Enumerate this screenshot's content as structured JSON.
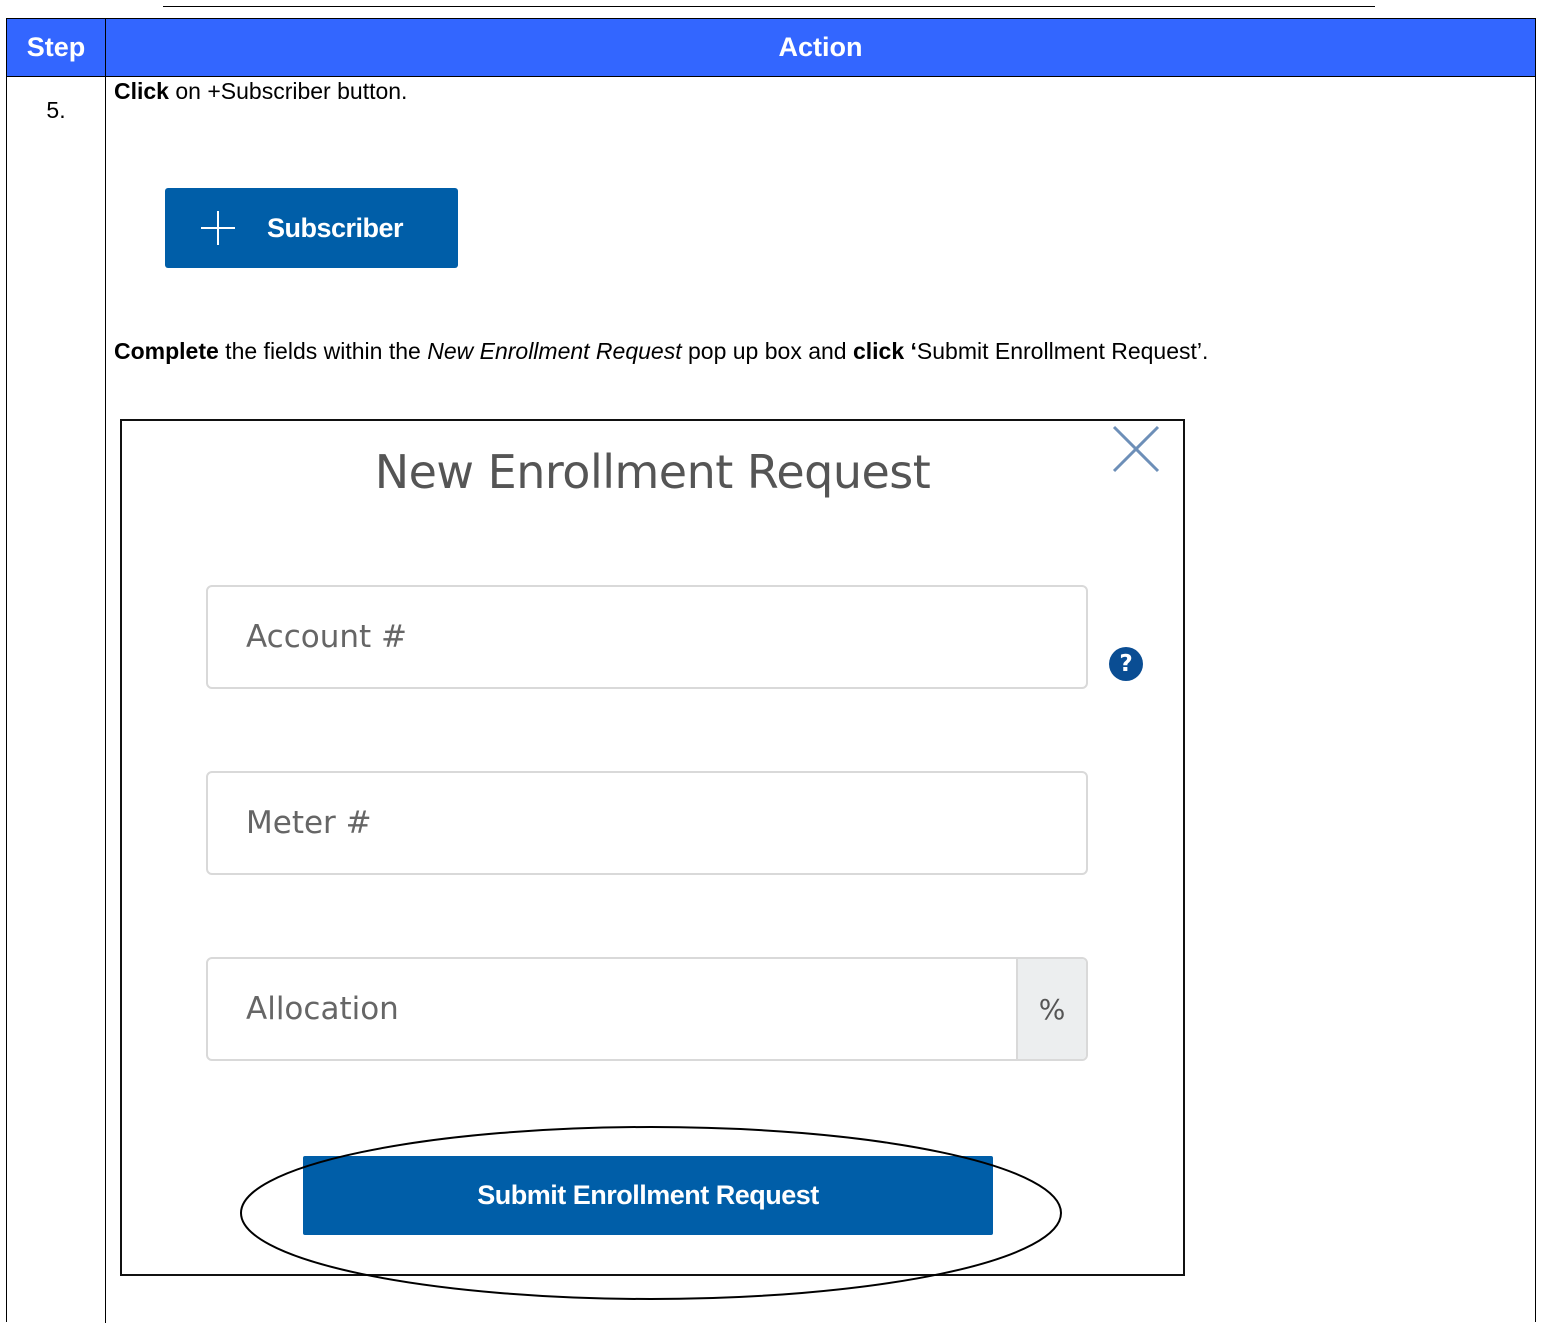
{
  "table": {
    "header": {
      "step": "Step",
      "action": "Action"
    },
    "row": {
      "step_number": "5."
    }
  },
  "instructions": {
    "line1": {
      "verb": "Click",
      "rest": " on +Subscriber button."
    },
    "line2": {
      "verb": "Complete",
      "part_a": " the fields within the ",
      "italic": "New Enrollment Request",
      "part_b": " pop up box and ",
      "verb2": "click",
      "part_c": " ‘",
      "part_d": "Submit Enrollment Request’."
    }
  },
  "subscriber_button": {
    "label": "Subscriber",
    "icon": "plus-icon"
  },
  "modal": {
    "title": "New Enrollment Request",
    "close_icon": "close-icon",
    "fields": {
      "account": {
        "placeholder": "Account #",
        "value": ""
      },
      "meter": {
        "placeholder": "Meter #",
        "value": ""
      },
      "allocation": {
        "placeholder": "Allocation",
        "value": "",
        "addon": "%"
      }
    },
    "help_icon": "?",
    "submit_label": "Submit Enrollment Request"
  },
  "colors": {
    "header_bg": "#3366ff",
    "button_bg": "#005ea8",
    "help_icon_bg": "#0a4d93",
    "close_icon": "#6d8fb8"
  }
}
